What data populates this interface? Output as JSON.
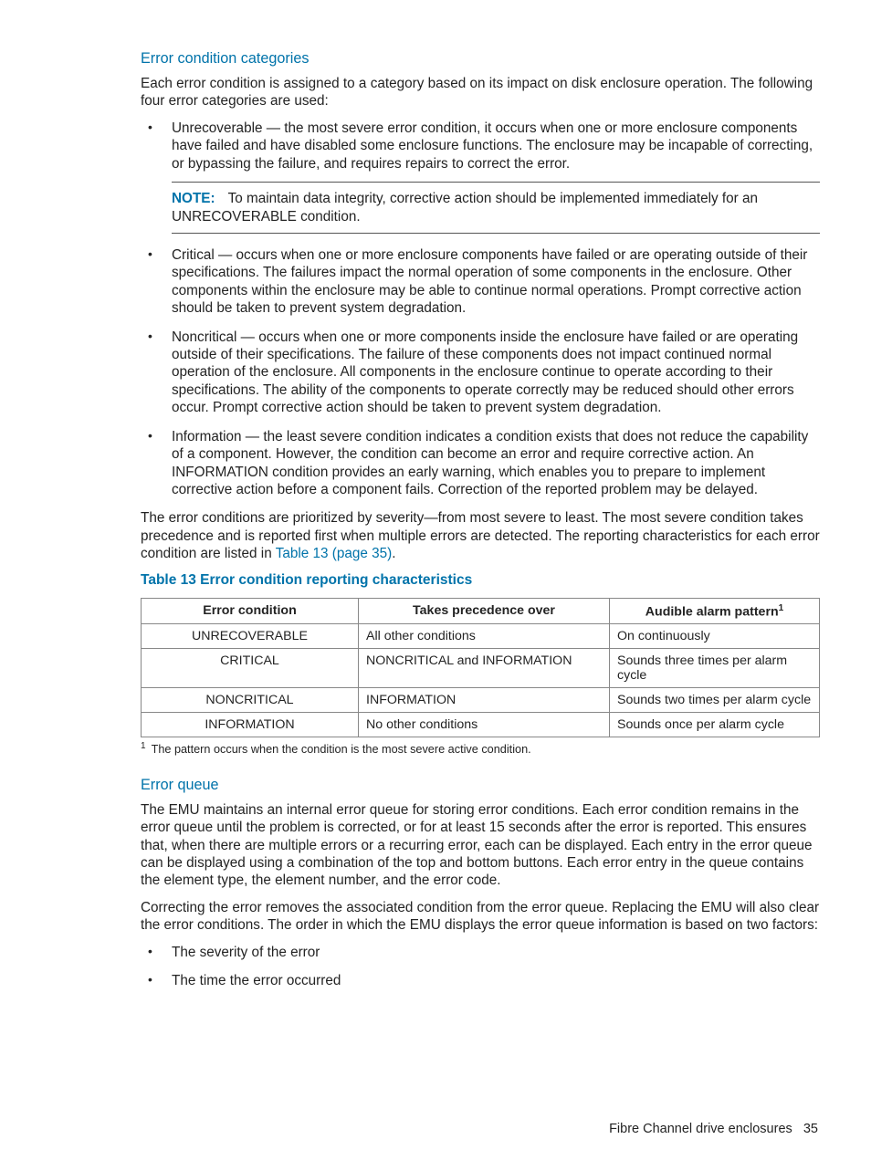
{
  "section1_heading": "Error condition categories",
  "section1_intro": "Each error condition is assigned to a category based on its impact on disk enclosure operation. The following four error categories are used:",
  "categories": [
    "Unrecoverable — the most severe error condition, it occurs when one or more enclosure components have failed and have disabled some enclosure functions. The enclosure may be incapable of correcting, or bypassing the failure, and requires repairs to correct the error.",
    "Critical — occurs when one or more enclosure components have failed or are operating outside of their specifications. The failures impact the normal operation of some components in the enclosure. Other components within the enclosure may be able to continue normal operations. Prompt corrective action should be taken to prevent system degradation.",
    "Noncritical — occurs when one or more components inside the enclosure have failed or are operating outside of their specifications. The failure of these components does not impact continued normal operation of the enclosure. All components in the enclosure continue to operate according to their specifications. The ability of the components to operate correctly may be reduced should other errors occur. Prompt corrective action should be taken to prevent system degradation.",
    "Information — the least severe condition indicates a condition exists that does not reduce the capability of a component. However, the condition can become an error and require corrective action. An INFORMATION condition provides an early warning, which enables you to prepare to implement corrective action before a component fails. Correction of the reported problem may be delayed."
  ],
  "note_label": "NOTE:",
  "note_text": "To maintain data integrity, corrective action should be implemented immediately for an UNRECOVERABLE condition.",
  "priority_para_a": "The error conditions are prioritized by severity—from most severe to least. The most severe condition takes precedence and is reported first when multiple errors are detected. The reporting characteristics for each error condition are listed in ",
  "priority_link": "Table 13 (page 35)",
  "priority_para_b": ".",
  "table_caption": "Table 13 Error condition reporting characteristics",
  "table_headers": [
    "Error condition",
    "Takes precedence over",
    "Audible alarm pattern"
  ],
  "table_header_sup": "1",
  "table_rows": [
    [
      "UNRECOVERABLE",
      "All other conditions",
      "On continuously"
    ],
    [
      "CRITICAL",
      "NONCRITICAL and INFORMATION",
      "Sounds three times per alarm cycle"
    ],
    [
      "NONCRITICAL",
      "INFORMATION",
      "Sounds two times per alarm cycle"
    ],
    [
      "INFORMATION",
      "No other conditions",
      "Sounds once per alarm cycle"
    ]
  ],
  "footnote_sup": "1",
  "footnote_text": "The pattern occurs when the condition is the most severe active condition.",
  "section2_heading": "Error queue",
  "section2_p1": "The EMU maintains an internal error queue for storing error conditions. Each error condition remains in the error queue until the problem is corrected, or for at least 15 seconds after the error is reported. This ensures that, when there are multiple errors or a recurring error, each can be displayed. Each entry in the error queue can be displayed using a combination of the top and bottom buttons. Each error entry in the queue contains the element type, the element number, and the error code.",
  "section2_p2": "Correcting the error removes the associated condition from the error queue. Replacing the EMU will also clear the error conditions. The order in which the EMU displays the error queue information is based on two factors:",
  "factors": [
    "The severity of the error",
    "The time the error occurred"
  ],
  "footer_text": "Fibre Channel drive enclosures",
  "footer_page": "35"
}
